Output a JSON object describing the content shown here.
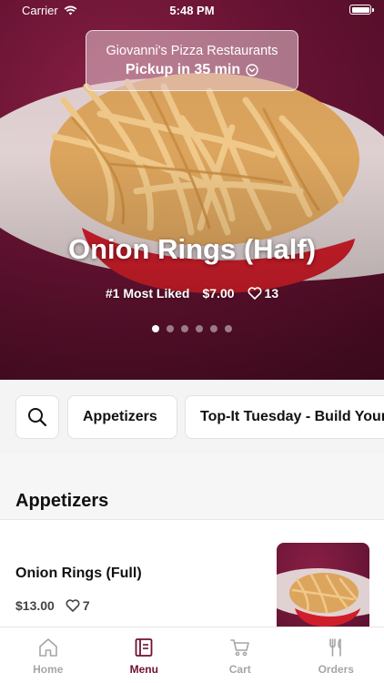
{
  "status_bar": {
    "carrier": "Carrier",
    "time": "5:48 PM"
  },
  "pickup": {
    "restaurant": "Giovanni's Pizza Restaurants",
    "label": "Pickup in 35 min"
  },
  "hero": {
    "title": "Onion Rings (Half)",
    "badge": "#1 Most Liked",
    "price": "$7.00",
    "likes": "13",
    "slide_count": 6,
    "active_slide": 1
  },
  "categories": {
    "items": [
      "Appetizers",
      "Top-It Tuesday - Build Your"
    ]
  },
  "section": {
    "title": "Appetizers"
  },
  "menu_items": [
    {
      "name": "Onion Rings (Full)",
      "price": "$13.00",
      "likes": "7"
    }
  ],
  "tab_bar": {
    "tabs": [
      {
        "label": "Home",
        "icon": "home-icon",
        "active": false
      },
      {
        "label": "Menu",
        "icon": "menu-book-icon",
        "active": true
      },
      {
        "label": "Cart",
        "icon": "cart-icon",
        "active": false
      },
      {
        "label": "Orders",
        "icon": "fork-knife-icon",
        "active": false
      }
    ]
  },
  "colors": {
    "accent": "#6f1133",
    "hero_background": "#6a1334",
    "inactive_tab": "#a6a6a6"
  }
}
